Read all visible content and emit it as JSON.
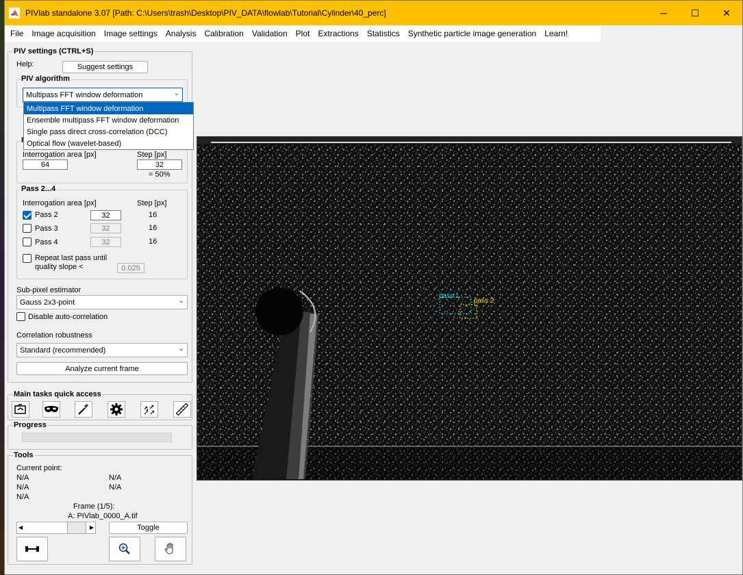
{
  "window": {
    "title": "PIVlab standalone 3.07   [Path: C:\\Users\\trash\\Desktop\\PIV_DATA\\flowlab\\Tutorial\\Cylinder\\40_perc]",
    "minimize": "─",
    "maximize": "☐",
    "close": "✕"
  },
  "menu": [
    "File",
    "Image acquisition",
    "Image settings",
    "Analysis",
    "Calibration",
    "Validation",
    "Plot",
    "Extractions",
    "Statistics",
    "Synthetic particle image generation",
    "Learn!"
  ],
  "piv_settings": {
    "title": "PIV settings (CTRL+S)",
    "help_label": "Help:",
    "suggest_button": "Suggest settings",
    "algorithm_group": "PIV algorithm",
    "algorithm_selected": "Multipass FFT window deformation",
    "algorithm_options": [
      "Multipass FFT window deformation",
      "Ensemble multipass FFT window deformation",
      "Single pass direct cross-correlation (DCC)",
      "Optical flow (wavelet-based)"
    ],
    "pass1": {
      "group_title": "P",
      "ia_label": "Interrogation area [px]",
      "step_label": "Step [px]",
      "ia_value": "64",
      "step_value": "32",
      "overlap": "= 50%"
    },
    "pass2_4": {
      "group_title": "Pass 2...4",
      "ia_label": "Interrogation area [px]",
      "step_label": "Step [px]",
      "passes": [
        {
          "label": "Pass 2",
          "checked": true,
          "ia": "32",
          "step": "16"
        },
        {
          "label": "Pass 3",
          "checked": false,
          "ia": "32",
          "step": "16"
        },
        {
          "label": "Pass 4",
          "checked": false,
          "ia": "32",
          "step": "16"
        }
      ],
      "repeat_label_1": "Repeat last pass until",
      "repeat_label_2": "quality slope <",
      "quality_value": "0.025"
    },
    "subpixel_label": "Sub-pixel estimator",
    "subpixel_value": "Gauss 2x3-point",
    "disable_autocorr": "Disable auto-correlation",
    "robustness_label": "Correlation robustness",
    "robustness_value": "Standard (recommended)",
    "analyze_button": "Analyze current frame"
  },
  "quick_access": {
    "title": "Main tasks quick access",
    "icons": [
      "load-images-icon",
      "mask-icon",
      "wand-icon",
      "settings-gear-icon",
      "vectors-icon",
      "ruler-icon"
    ]
  },
  "progress": {
    "title": "Progress",
    "value": 0
  },
  "tools": {
    "title": "Tools",
    "current_point": "Current point:",
    "na": [
      "N/A",
      "N/A",
      "N/A",
      "N/A",
      "N/A"
    ],
    "frame_label": "Frame (1/5):",
    "frame_file": "A: PIVlab_0000_A.tif",
    "toggle_button": "Toggle"
  },
  "image": {
    "pass1_label": "pass 1",
    "pass2_label": "pass 2",
    "pass1_color": "#00e0e0",
    "pass2_color": "#e8e800"
  }
}
